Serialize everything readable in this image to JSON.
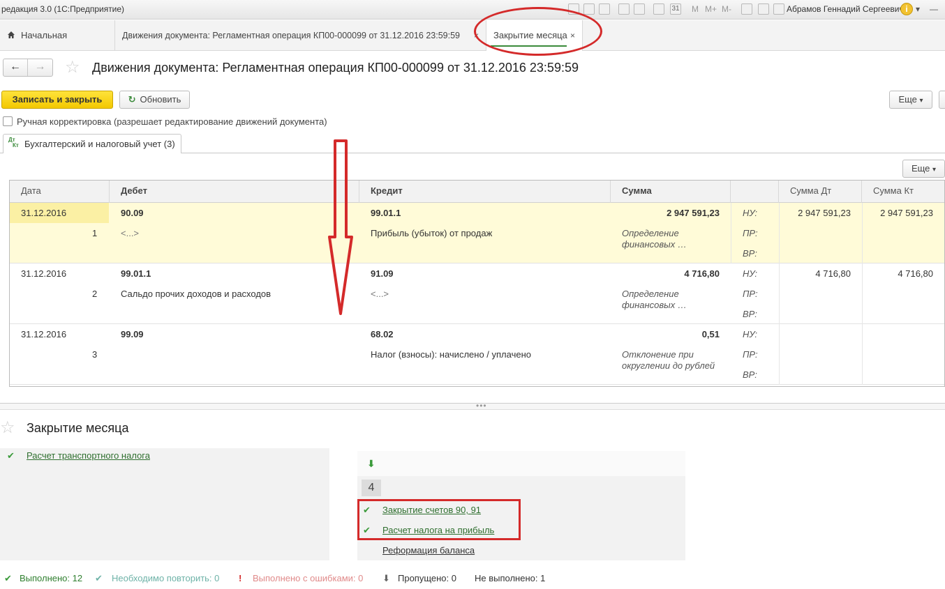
{
  "titlebar": {
    "app_title": "редакция 3.0 (1С:Предприятие)",
    "memory_buttons": [
      "M",
      "M+",
      "M-"
    ],
    "user_name": "Абрамов Геннадий Сергеевич",
    "info_glyph": "i",
    "calendar_glyph": "31",
    "icons": [
      "print-icon",
      "preview-icon",
      "save-icon",
      "calendar-icon",
      "zoom-icon",
      "panel-icon",
      "info-icon"
    ]
  },
  "tabs": [
    {
      "label": "Начальная страница",
      "icon": "home-icon"
    },
    {
      "label": "Движения документа: Регламентная операция КП00-000099 от 31.12.2016 23:59:59",
      "close": "×"
    },
    {
      "label": "Закрытие месяца",
      "close": "×",
      "active": true
    }
  ],
  "nav": {
    "back": "←",
    "forward": "→",
    "star": "☆"
  },
  "document": {
    "title": "Движения документа: Регламентная операция КП00-000099 от 31.12.2016 23:59:59"
  },
  "toolbar": {
    "save_close": "Записать и закрыть",
    "refresh": "Обновить",
    "refresh_glyph": "↻",
    "more": "Еще",
    "more_arrow": "▾"
  },
  "manual_edit": {
    "label": "Ручная корректировка (разрешает редактирование движений документа)",
    "checked": false
  },
  "register_tab": {
    "dt": "Дт",
    "kt": "Кт",
    "label": "Бухгалтерский и налоговый учет (3)"
  },
  "table": {
    "more": "Еще",
    "more_arrow": "▾",
    "headers": [
      "Дата",
      "Дебет",
      "Кредит",
      "Сумма",
      "",
      "Сумма Дт",
      "Сумма Кт"
    ],
    "rows": [
      {
        "date": "31.12.2016",
        "num": "1",
        "debit": "90.09",
        "debit_sub": "<...>",
        "credit": "99.01.1",
        "credit_sub": "Прибыль (убыток) от продаж",
        "sum": "2 947 591,23",
        "content": "Определение финансовых …",
        "nu": "НУ:",
        "pr": "ПР:",
        "vr": "ВР:",
        "sum_dt": "2 947 591,23",
        "sum_kt": "2 947 591,23"
      },
      {
        "date": "31.12.2016",
        "num": "2",
        "debit": "99.01.1",
        "debit_sub": "Сальдо прочих доходов и расходов",
        "credit": "91.09",
        "credit_sub": "<...>",
        "sum": "4 716,80",
        "content": "Определение финансовых …",
        "nu": "НУ:",
        "pr": "ПР:",
        "vr": "ВР:",
        "sum_dt": "4 716,80",
        "sum_kt": "4 716,80"
      },
      {
        "date": "31.12.2016",
        "num": "3",
        "debit": "99.09",
        "debit_sub": "",
        "credit": "68.02",
        "credit_sub": "Налог (взносы): начислено / уплачено",
        "sum": "0,51",
        "content": "Отклонение при округлении до рублей",
        "nu": "НУ:",
        "pr": "ПР:",
        "vr": "ВР:",
        "sum_dt": "",
        "sum_kt": ""
      }
    ]
  },
  "splitter": {
    "dots": "•••"
  },
  "closing": {
    "star": "☆",
    "title": "Закрытие месяца",
    "left_items": [
      {
        "label": "Расчет транспортного налога",
        "check": "✔"
      }
    ],
    "down_arrow": "⬇",
    "step_number": "4",
    "right_items": [
      {
        "label": "Закрытие счетов 90, 91",
        "check": "✔"
      },
      {
        "label": "Расчет налога на прибыль",
        "check": "✔"
      },
      {
        "label": "Реформация баланса",
        "check": ""
      }
    ]
  },
  "status": {
    "done": {
      "glyph": "✔",
      "label": "Выполнено: 12"
    },
    "repeat": {
      "glyph": "✔",
      "label": "Необходимо повторить: 0"
    },
    "errors": {
      "glyph": "!",
      "label": "Выполнено с ошибками: 0"
    },
    "skipped": {
      "glyph": "⬇",
      "label": "Пропущено: 0"
    },
    "not_done": {
      "label": "Не выполнено: 1"
    }
  },
  "colors": {
    "primary_button": "#f3c800",
    "accent_green": "#3a9a3a",
    "annotation_red": "#d42a2a",
    "selected_row": "#fffbd8"
  }
}
